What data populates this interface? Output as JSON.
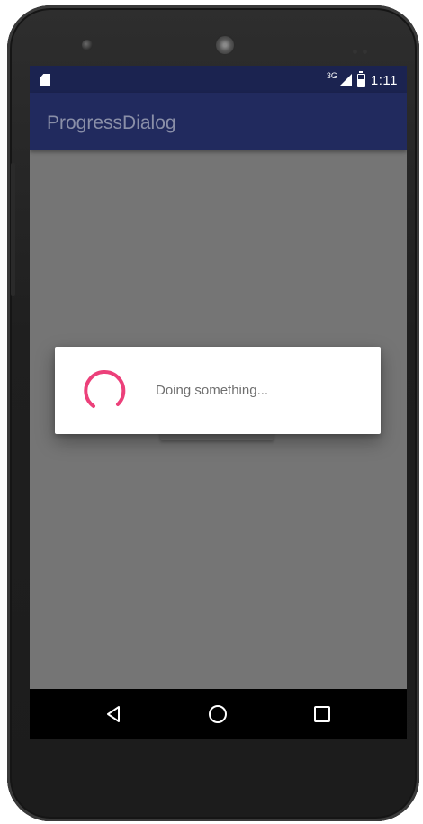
{
  "device": {
    "icons": [
      "front-camera-icon",
      "speaker-icon",
      "sensor-icon"
    ]
  },
  "status_bar": {
    "network_label": "3G",
    "time": "1:11",
    "icons": [
      "sd-card-icon",
      "signal-icon",
      "battery-icon"
    ]
  },
  "app_bar": {
    "title": "ProgressDialog"
  },
  "dialog": {
    "message": "Doing something...",
    "spinner_color": "#ec407a"
  },
  "nav_bar": {
    "buttons": [
      "back-icon",
      "home-icon",
      "recent-apps-icon"
    ]
  },
  "colors": {
    "status_bar": "#1b2350",
    "app_bar": "#212a5e",
    "scrim": "#757575",
    "accent": "#ec407a"
  }
}
